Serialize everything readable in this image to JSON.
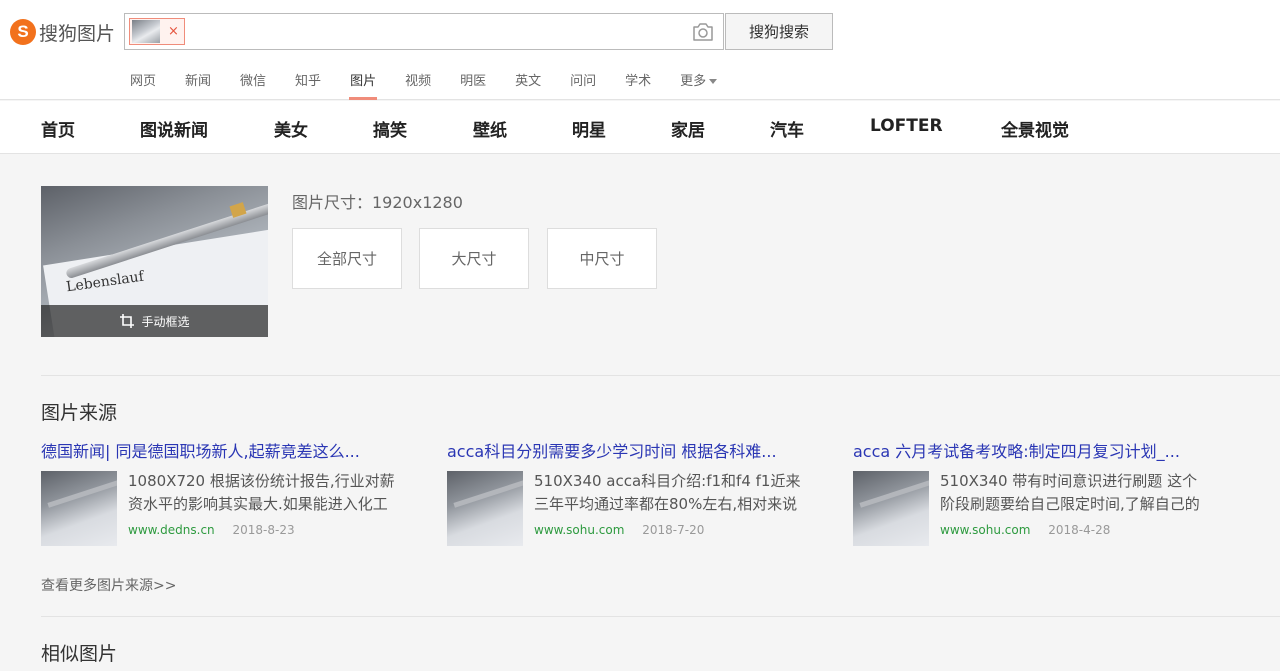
{
  "header": {
    "logo_text": "搜狗图片",
    "search_button": "搜狗搜索",
    "nav": [
      "网页",
      "新闻",
      "微信",
      "知乎",
      "图片",
      "视频",
      "明医",
      "英文",
      "问问",
      "学术",
      "更多"
    ],
    "nav_active_index": 4
  },
  "categories": [
    "首页",
    "图说新闻",
    "美女",
    "搞笑",
    "壁纸",
    "明星",
    "家居",
    "汽车",
    "LOFTER",
    "全景视觉"
  ],
  "preview": {
    "script_text": "Lebenslauf",
    "crop_label": "手动框选"
  },
  "size": {
    "label": "图片尺寸：1920x1280",
    "buttons": [
      "全部尺寸",
      "大尺寸",
      "中尺寸"
    ]
  },
  "sources": {
    "title": "图片来源",
    "items": [
      {
        "title": "德国新闻| 同是德国职场新人,起薪竟差这么...",
        "desc": "1080X720 根据该份统计报告,行业对薪资水平的影响其实最大.如果能进入化工",
        "domain": "www.dedns.cn",
        "date": "2018-8-23"
      },
      {
        "title": "acca科目分别需要多少学习时间 根据各科难...",
        "desc": "510X340 acca科目介绍:f1和f4 f1近来三年平均通过率都在80%左右,相对来说",
        "domain": "www.sohu.com",
        "date": "2018-7-20"
      },
      {
        "title": "acca 六月考试备考攻略:制定四月复习计划_...",
        "desc": "510X340 带有时间意识进行刷题 这个阶段刷题要给自己限定时间,了解自己的",
        "domain": "www.sohu.com",
        "date": "2018-4-28"
      }
    ],
    "more": "查看更多图片来源>>"
  },
  "similar": {
    "title": "相似图片"
  },
  "colors": {
    "accent": "#f08c7a",
    "link_blue": "#2a36b4",
    "domain_green": "#2d9a3f"
  }
}
